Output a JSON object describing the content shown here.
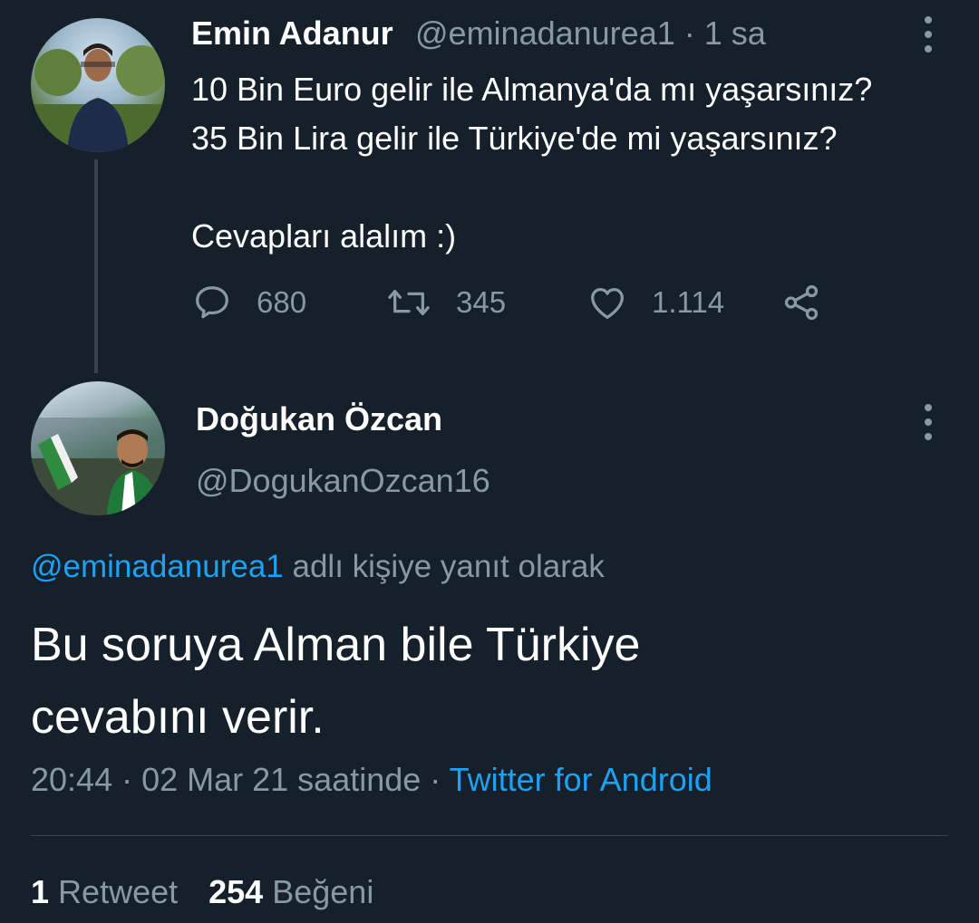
{
  "parent_tweet": {
    "author_name": "Emin Adanur",
    "handle": "@eminadanurea1",
    "time_sep": "·",
    "time": "1 sa",
    "text_lines": [
      "10 Bin Euro gelir ile Almanya'da mı yaşarsınız?",
      "35 Bin Lira gelir ile Türkiye'de mi yaşarsınız?",
      "",
      "Cevapları alalım :)"
    ],
    "actions": {
      "reply_icon": "comment-icon",
      "reply_count": "680",
      "retweet_icon": "retweet-icon",
      "retweet_count": "345",
      "like_icon": "heart-icon",
      "like_count": "1.114",
      "share_icon": "share-icon"
    }
  },
  "main_tweet": {
    "author_name": "Doğukan Özcan",
    "handle": "@DogukanOzcan16",
    "reply_to_mention": "@eminadanurea1",
    "reply_to_suffix": " adlı kişiye yanıt olarak",
    "text_lines": [
      "Bu soruya Alman bile Türkiye",
      "cevabını verir."
    ],
    "timestamp": "20:44 · 02 Mar 21 saatinde · ",
    "source": "Twitter for Android",
    "retweet_count": "1",
    "retweet_label": "Retweet",
    "like_count": "254",
    "like_label": "Beğeni"
  },
  "colors": {
    "background": "#15202b",
    "secondary_text": "#8899a6",
    "link": "#1da1f2",
    "divider": "#38444d"
  }
}
